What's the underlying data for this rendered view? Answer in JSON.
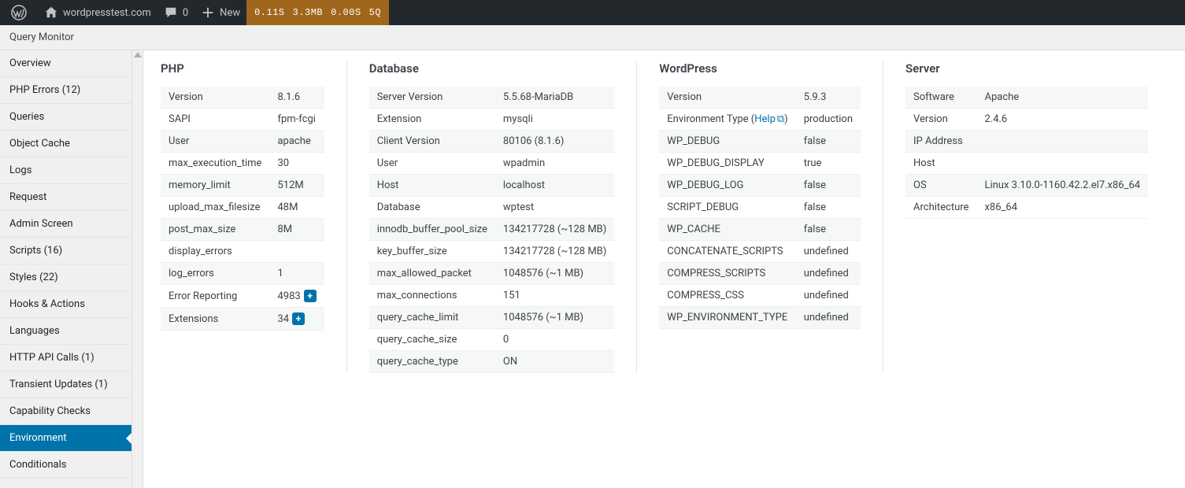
{
  "adminbar": {
    "site": "wordpresstest.com",
    "comments": "0",
    "new": "New",
    "qm": {
      "time": "0.11S",
      "mem": "3.3MB",
      "dbtime": "0.00S",
      "queries": "5Q"
    }
  },
  "title": "Query Monitor",
  "sidebar": {
    "items": [
      {
        "label": "Overview"
      },
      {
        "label": "PHP Errors (12)"
      },
      {
        "label": "Queries"
      },
      {
        "label": "Object Cache"
      },
      {
        "label": "Logs"
      },
      {
        "label": "Request"
      },
      {
        "label": "Admin Screen"
      },
      {
        "label": "Scripts (16)"
      },
      {
        "label": "Styles (22)"
      },
      {
        "label": "Hooks & Actions"
      },
      {
        "label": "Languages"
      },
      {
        "label": "HTTP API Calls (1)"
      },
      {
        "label": "Transient Updates (1)"
      },
      {
        "label": "Capability Checks"
      },
      {
        "label": "Environment",
        "active": true
      },
      {
        "label": "Conditionals"
      }
    ]
  },
  "panels": {
    "php": {
      "heading": "PHP",
      "rows": [
        {
          "k": "Version",
          "v": "8.1.6"
        },
        {
          "k": "SAPI",
          "v": "fpm-fcgi"
        },
        {
          "k": "User",
          "v": "apache"
        },
        {
          "k": "max_execution_time",
          "v": "30"
        },
        {
          "k": "memory_limit",
          "v": "512M"
        },
        {
          "k": "upload_max_filesize",
          "v": "48M"
        },
        {
          "k": "post_max_size",
          "v": "8M"
        },
        {
          "k": "display_errors",
          "v": ""
        },
        {
          "k": "log_errors",
          "v": "1"
        },
        {
          "k": "Error Reporting",
          "v": "4983",
          "badge": "+"
        },
        {
          "k": "Extensions",
          "v": "34",
          "badge": "+"
        }
      ]
    },
    "db": {
      "heading": "Database",
      "rows": [
        {
          "k": "Server Version",
          "v": "5.5.68-MariaDB"
        },
        {
          "k": "Extension",
          "v": "mysqli"
        },
        {
          "k": "Client Version",
          "v": "80106 (8.1.6)"
        },
        {
          "k": "User",
          "v": "wpadmin"
        },
        {
          "k": "Host",
          "v": "localhost"
        },
        {
          "k": "Database",
          "v": "wptest"
        },
        {
          "k": "innodb_buffer_pool_size",
          "v": "134217728 (~128 MB)"
        },
        {
          "k": "key_buffer_size",
          "v": "134217728 (~128 MB)"
        },
        {
          "k": "max_allowed_packet",
          "v": "1048576 (~1 MB)"
        },
        {
          "k": "max_connections",
          "v": "151"
        },
        {
          "k": "query_cache_limit",
          "v": "1048576 (~1 MB)"
        },
        {
          "k": "query_cache_size",
          "v": "0"
        },
        {
          "k": "query_cache_type",
          "v": "ON"
        }
      ]
    },
    "wp": {
      "heading": "WordPress",
      "help_label": "Help",
      "rows": [
        {
          "k": "Version",
          "v": "5.9.3"
        },
        {
          "k": "Environment Type",
          "v": "production",
          "help": true
        },
        {
          "k": "WP_DEBUG",
          "v": "false"
        },
        {
          "k": "WP_DEBUG_DISPLAY",
          "v": "true"
        },
        {
          "k": "WP_DEBUG_LOG",
          "v": "false"
        },
        {
          "k": "SCRIPT_DEBUG",
          "v": "false"
        },
        {
          "k": "WP_CACHE",
          "v": "false"
        },
        {
          "k": "CONCATENATE_SCRIPTS",
          "v": "undefined"
        },
        {
          "k": "COMPRESS_SCRIPTS",
          "v": "undefined"
        },
        {
          "k": "COMPRESS_CSS",
          "v": "undefined"
        },
        {
          "k": "WP_ENVIRONMENT_TYPE",
          "v": "undefined"
        }
      ]
    },
    "server": {
      "heading": "Server",
      "rows": [
        {
          "k": "Software",
          "v": "Apache"
        },
        {
          "k": "Version",
          "v": "2.4.6"
        },
        {
          "k": "IP Address",
          "v": ""
        },
        {
          "k": "Host",
          "v": ""
        },
        {
          "k": "OS",
          "v": "Linux 3.10.0-1160.42.2.el7.x86_64"
        },
        {
          "k": "Architecture",
          "v": "x86_64"
        }
      ]
    }
  }
}
